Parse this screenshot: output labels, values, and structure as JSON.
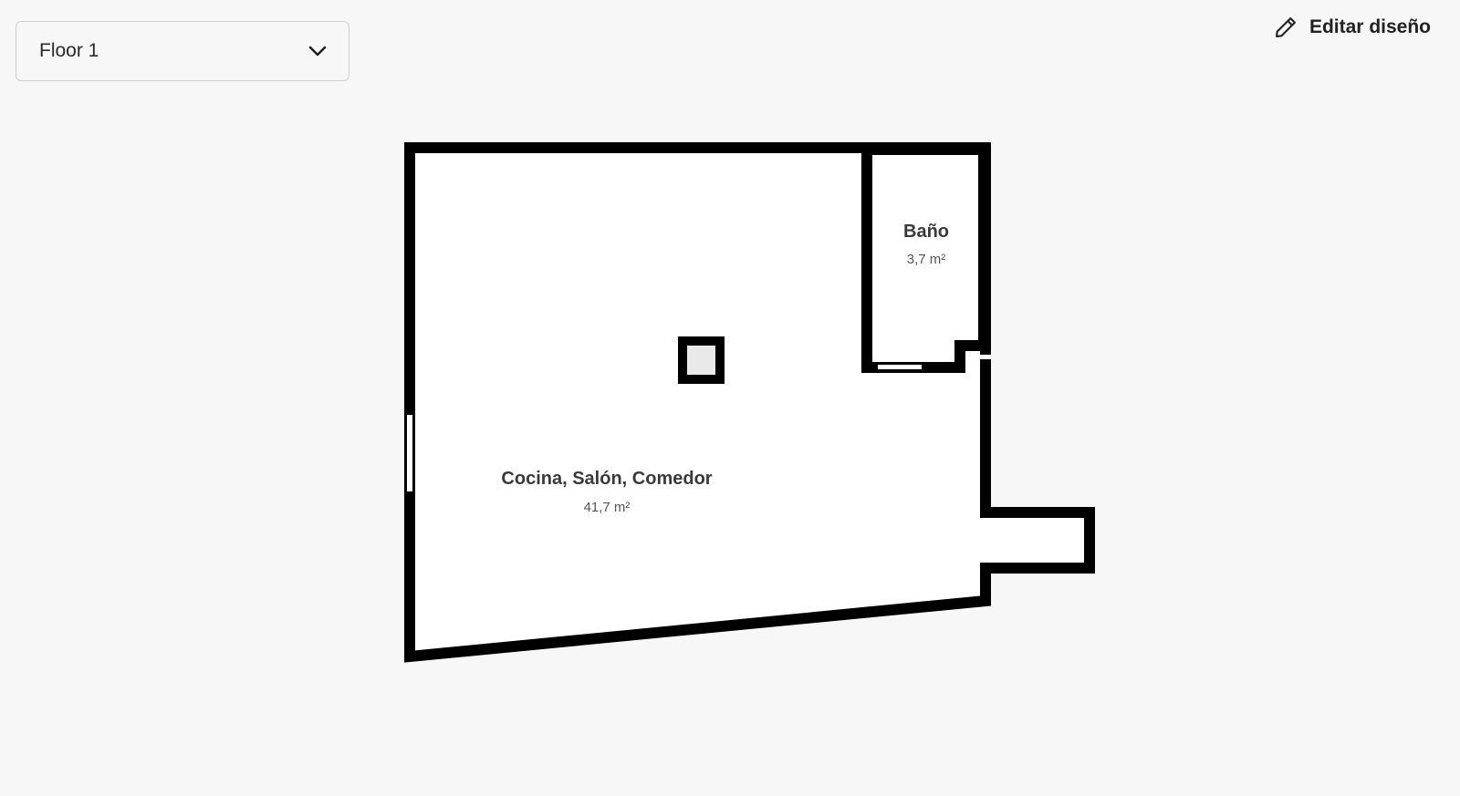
{
  "floor_selector": {
    "selected": "Floor 1",
    "icon": "chevron-down-icon"
  },
  "toolbar": {
    "edit_design_label": "Editar diseño",
    "edit_icon": "pencil-icon"
  },
  "rooms": [
    {
      "name": "Baño",
      "area": "3,7 m²"
    },
    {
      "name": "Cocina, Salón, Comedor",
      "area": "41,7 m²"
    }
  ],
  "colors": {
    "background": "#f7f7f7",
    "wall": "#000000",
    "room_fill": "#ffffff"
  }
}
